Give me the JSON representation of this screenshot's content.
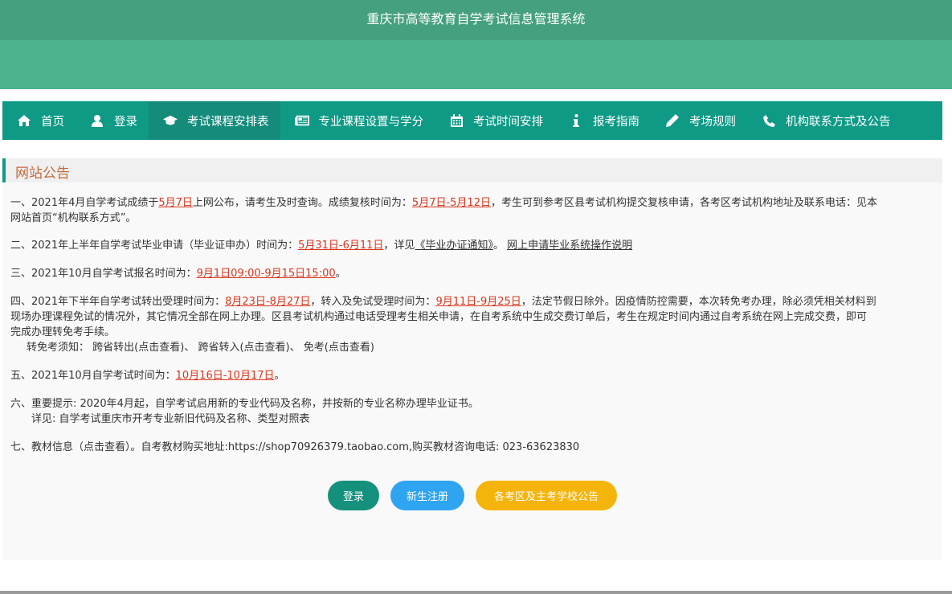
{
  "site": {
    "title": "重庆市高等教育自学考试信息管理系统"
  },
  "nav": {
    "items": [
      {
        "label": "首页",
        "icon": "home-icon"
      },
      {
        "label": "登录",
        "icon": "user-icon"
      },
      {
        "label": "考试课程安排表",
        "icon": "graduation-cap-icon"
      },
      {
        "label": "专业课程设置与学分",
        "icon": "newspaper-icon"
      },
      {
        "label": "考试时间安排",
        "icon": "calendar-icon"
      },
      {
        "label": "报考指南",
        "icon": "info-icon"
      },
      {
        "label": "考场规则",
        "icon": "pencil-icon"
      },
      {
        "label": "机构联系方式及公告",
        "icon": "phone-icon"
      }
    ]
  },
  "panel": {
    "title": "网站公告"
  },
  "notices": {
    "n1": {
      "prefix": "一、2021年4月自学考试成绩于",
      "date1": "5月7日",
      "mid1": "上网公布，请考生及时查询。成绩复核时间为：",
      "date2": "5月7日-5月12日",
      "mid2": "，考生可到参考区县考试机构提交复核申请，各考区考试机构地址及联系电话：见本",
      "line2": "网站首页“机构联系方式”。"
    },
    "n2": {
      "prefix": "二、2021年上半年自学考试毕业申请（毕业证申办）时间为：",
      "date": "5月31日-6月11日",
      "mid": "，详见",
      "link1": "《毕业办证通知》",
      "sep": "。 ",
      "link2": "网上申请毕业系统操作说明"
    },
    "n3": {
      "prefix": "三、2021年10月自学考试报名时间为：",
      "date": "9月1日09:00-9月15日15:00",
      "suffix": "。"
    },
    "n4": {
      "prefix": "四、2021年下半年自学考试转出受理时间为：",
      "date1": "8月23日-8月27日",
      "mid1": "，转入及免试受理时间为：",
      "date2": "9月11日-9月25日",
      "mid2": "，法定节假日除外。因疫情防控需要，本次转免考办理，除必须凭相关材料到",
      "line2": "现场办理课程免试的情况外，其它情况全部在网上办理。区县考试机构通过电话受理考生相关申请，在自考系统中生成交费订单后，考生在规定时间内通过自考系统在网上完成交费，即可",
      "line3": "完成办理转免考手续。",
      "sub_label": "转免考须知：",
      "sub_link1": "跨省转出(点击查看)",
      "sub_sep1": "、",
      "sub_link2": "跨省转入(点击查看)",
      "sub_sep2": "、",
      "sub_link3": "免考(点击查看)"
    },
    "n5": {
      "prefix": "五、2021年10月自学考试时间为：",
      "date": "10月16日-10月17日",
      "suffix": "。"
    },
    "n6": {
      "line1": "六、重要提示: 2020年4月起，自学考试启用新的专业代码及名称，并按新的专业名称办理毕业证书。",
      "sub_label": "详见: ",
      "sub_link": "自学考试重庆市开考专业新旧代码及名称、类型对照表"
    },
    "n7": {
      "link": "七、教材信息（点击查看）",
      "text": "。自考教材购买地址:https://shop70926379.taobao.com,购买教材咨询电话:  023-63623830"
    }
  },
  "buttons": {
    "login": "登录",
    "register": "新生注册",
    "notices": "各考区及主考学校公告"
  },
  "colors": {
    "banner_dark": "#45a07f",
    "banner_light": "#4cb38c",
    "nav": "#0f9a86",
    "highlight_red": "#d9361d",
    "panel_title": "#c56a3c",
    "btn_login": "#14907c",
    "btn_register": "#2fa4f0",
    "btn_notices": "#f5b40c"
  }
}
